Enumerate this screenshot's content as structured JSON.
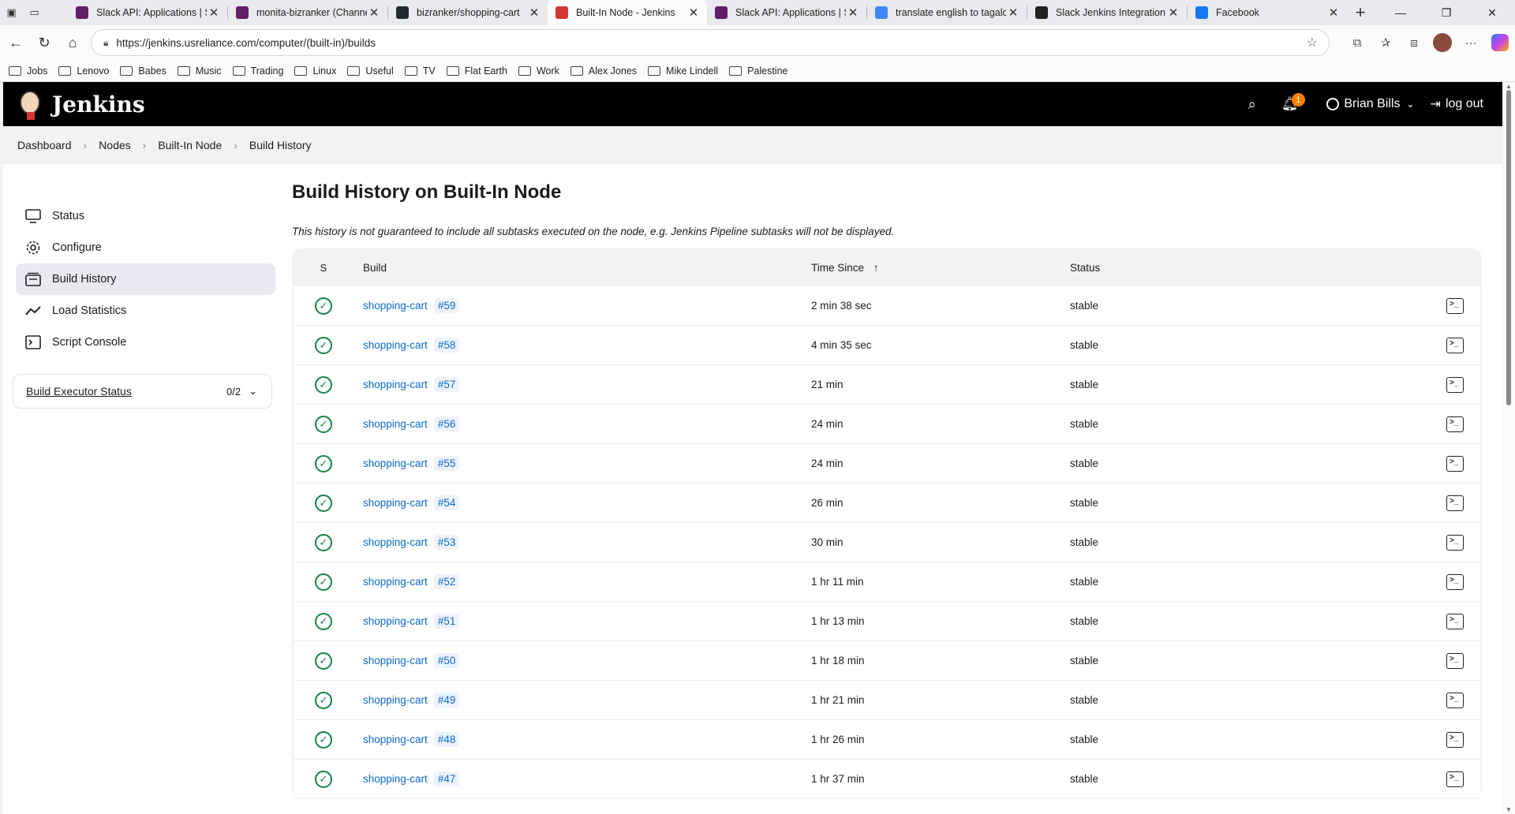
{
  "browser": {
    "tabs": [
      {
        "title": "Slack API: Applications | Sl",
        "icon": "slack-icon",
        "color": "#611f69"
      },
      {
        "title": "monita-bizranker (Channel",
        "icon": "slack-icon",
        "color": "#611f69"
      },
      {
        "title": "bizranker/shopping-cart",
        "icon": "github-icon",
        "color": "#24292f"
      },
      {
        "title": "Built-In Node - Jenkins",
        "icon": "jenkins-icon",
        "color": "#d33833",
        "active": true
      },
      {
        "title": "Slack API: Applications | Sl",
        "icon": "slack-icon",
        "color": "#611f69"
      },
      {
        "title": "translate english to tagalog",
        "icon": "google-icon",
        "color": "#4285f4"
      },
      {
        "title": "Slack Jenkins Integration",
        "icon": "chatgpt-icon",
        "color": "#222222"
      },
      {
        "title": "Facebook",
        "icon": "facebook-icon",
        "color": "#1877f2"
      }
    ],
    "url": "https://jenkins.usreliance.com/computer/(built-in)/builds",
    "bookmarks": [
      "Jobs",
      "Lenovo",
      "Babes",
      "Music",
      "Trading",
      "Linux",
      "Useful",
      "TV",
      "Flat Earth",
      "Work",
      "Alex Jones",
      "Mike Lindell",
      "Palestine"
    ]
  },
  "header": {
    "brand": "Jenkins",
    "notification_count": "1",
    "user": "Brian Bills",
    "logout": "log out"
  },
  "breadcrumbs": [
    "Dashboard",
    "Nodes",
    "Built-In Node",
    "Build History"
  ],
  "sidebar": {
    "items": [
      {
        "label": "Status",
        "icon": "monitor-icon"
      },
      {
        "label": "Configure",
        "icon": "gear-icon"
      },
      {
        "label": "Build History",
        "icon": "history-icon",
        "active": true
      },
      {
        "label": "Load Statistics",
        "icon": "chart-line-icon"
      },
      {
        "label": "Script Console",
        "icon": "terminal-icon"
      }
    ],
    "executor": {
      "label": "Build Executor Status",
      "count": "0/2"
    }
  },
  "main": {
    "title": "Build History on Built-In Node",
    "note": "This history is not guaranteed to include all subtasks executed on the node, e.g. Jenkins Pipeline subtasks will not be displayed.",
    "columns": {
      "s": "S",
      "build": "Build",
      "time": "Time Since",
      "sort": "↑",
      "status": "Status"
    },
    "rows": [
      {
        "job": "shopping-cart",
        "number": "#59",
        "time": "2 min 38 sec",
        "status": "stable"
      },
      {
        "job": "shopping-cart",
        "number": "#58",
        "time": "4 min 35 sec",
        "status": "stable"
      },
      {
        "job": "shopping-cart",
        "number": "#57",
        "time": "21 min",
        "status": "stable"
      },
      {
        "job": "shopping-cart",
        "number": "#56",
        "time": "24 min",
        "status": "stable"
      },
      {
        "job": "shopping-cart",
        "number": "#55",
        "time": "24 min",
        "status": "stable"
      },
      {
        "job": "shopping-cart",
        "number": "#54",
        "time": "26 min",
        "status": "stable"
      },
      {
        "job": "shopping-cart",
        "number": "#53",
        "time": "30 min",
        "status": "stable"
      },
      {
        "job": "shopping-cart",
        "number": "#52",
        "time": "1 hr 11 min",
        "status": "stable"
      },
      {
        "job": "shopping-cart",
        "number": "#51",
        "time": "1 hr 13 min",
        "status": "stable"
      },
      {
        "job": "shopping-cart",
        "number": "#50",
        "time": "1 hr 18 min",
        "status": "stable"
      },
      {
        "job": "shopping-cart",
        "number": "#49",
        "time": "1 hr 21 min",
        "status": "stable"
      },
      {
        "job": "shopping-cart",
        "number": "#48",
        "time": "1 hr 26 min",
        "status": "stable"
      },
      {
        "job": "shopping-cart",
        "number": "#47",
        "time": "1 hr 37 min",
        "status": "stable"
      }
    ]
  }
}
